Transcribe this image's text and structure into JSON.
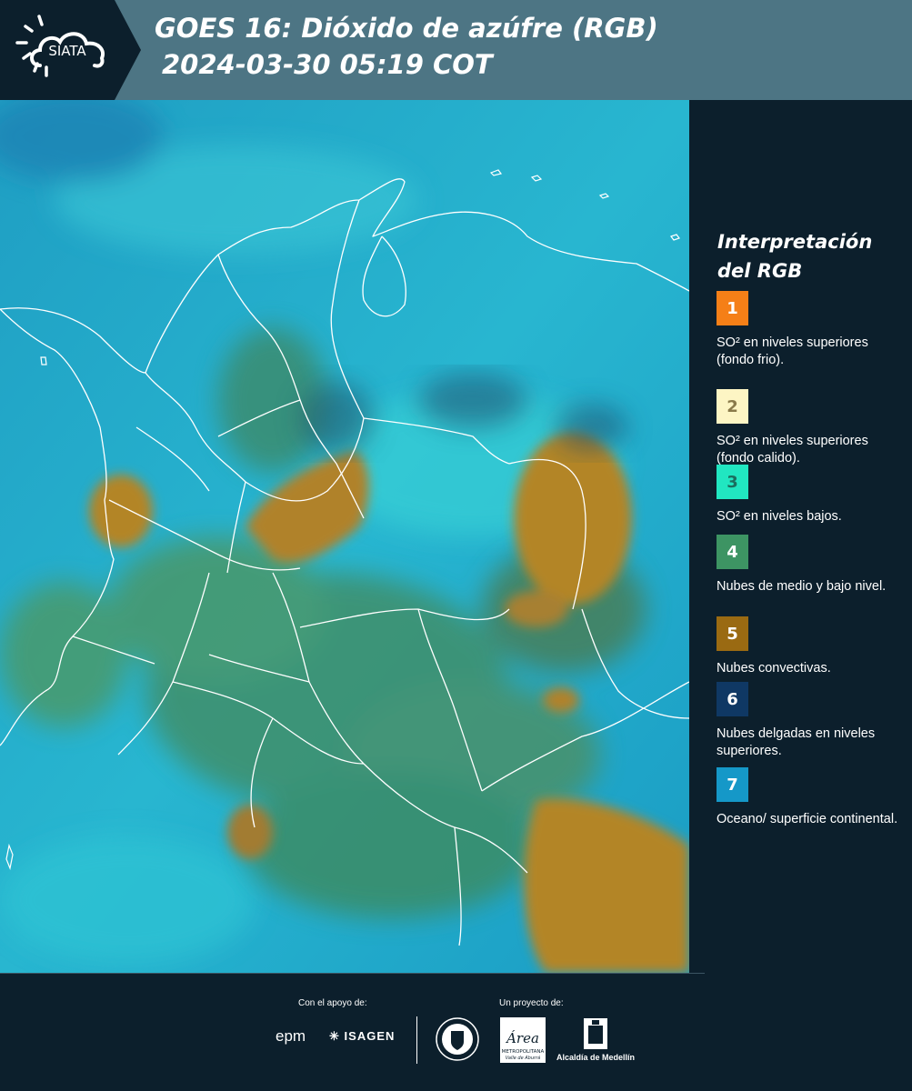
{
  "header": {
    "logo_text": "SIATA",
    "title_line1": "GOES 16: Dióxido de azúfre (RGB)",
    "title_line2": "2024-03-30 05:19 COT"
  },
  "legend": {
    "title_line1": "Interpretación",
    "title_line2": "del RGB",
    "items": [
      {
        "number": "1",
        "color": "#f57f17",
        "num_color": "#ffffff",
        "text": "SO² en niveles superiores (fondo frio)."
      },
      {
        "number": "2",
        "color": "#fdf5c4",
        "num_color": "#8a7a4a",
        "text": "SO² en niveles superiores (fondo calido)."
      },
      {
        "number": "3",
        "color": "#21e6c1",
        "num_color": "#1b6e5e",
        "text": "SO² en niveles bajos."
      },
      {
        "number": "4",
        "color": "#3d9463",
        "num_color": "#ffffff",
        "text": "Nubes de medio y bajo nivel."
      },
      {
        "number": "5",
        "color": "#9a6a12",
        "num_color": "#ffffff",
        "text": "Nubes convectivas."
      },
      {
        "number": "6",
        "color": "#0f3864",
        "num_color": "#ffffff",
        "text": "Nubes delgadas en niveles superiores."
      },
      {
        "number": "7",
        "color": "#1598c8",
        "num_color": "#ffffff",
        "text": "Oceano/ superficie continental."
      }
    ]
  },
  "footer": {
    "support_label": "Con el apoyo de:",
    "project_label": "Un proyecto de:",
    "epm": "epm",
    "isagen": "ISAGEN",
    "area_name": "Área",
    "area_sub1": "METROPOLITANA",
    "area_sub2": "Valle de Aburrá",
    "alcaldia": "Alcaldía de Medellín"
  }
}
